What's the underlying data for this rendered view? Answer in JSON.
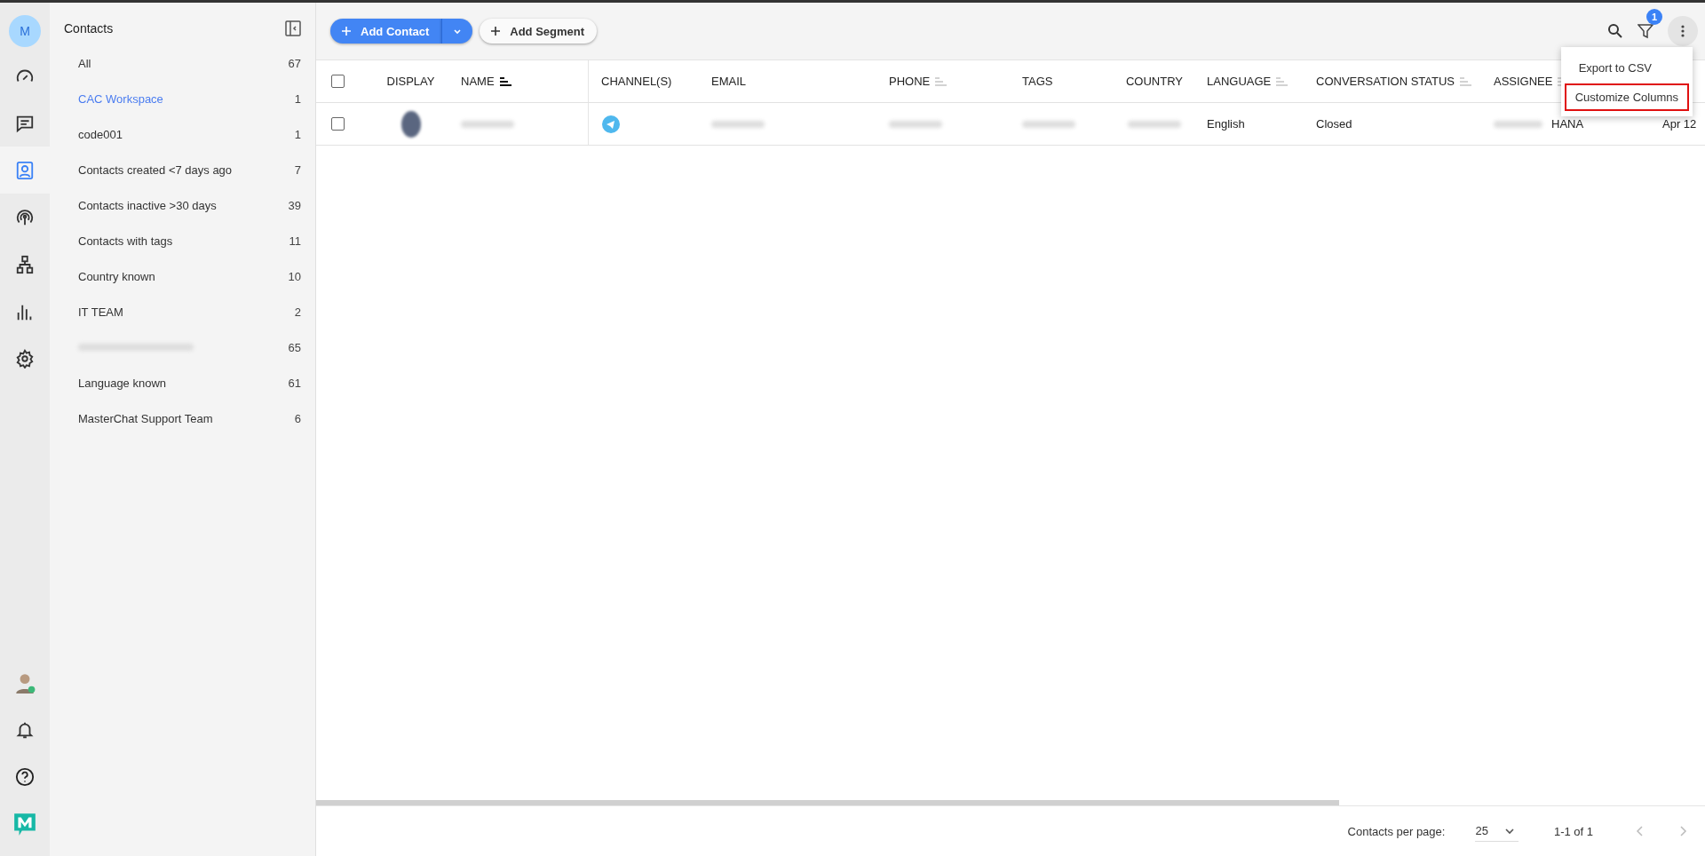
{
  "rail": {
    "avatar_initial": "M",
    "items": [
      {
        "selected": false
      },
      {
        "selected": false
      },
      {
        "selected": true
      },
      {
        "selected": false
      },
      {
        "selected": false
      },
      {
        "selected": false
      },
      {
        "selected": false
      }
    ]
  },
  "sidebar": {
    "title": "Contacts",
    "segments": [
      {
        "label": "All",
        "count": "67",
        "selected": false
      },
      {
        "label": "CAC Workspace",
        "count": "1",
        "selected": true
      },
      {
        "label": "code001",
        "count": "1",
        "selected": false
      },
      {
        "label": "Contacts created <7 days ago",
        "count": "7",
        "selected": false
      },
      {
        "label": "Contacts inactive >30 days",
        "count": "39",
        "selected": false
      },
      {
        "label": "Contacts with tags",
        "count": "11",
        "selected": false
      },
      {
        "label": "Country known",
        "count": "10",
        "selected": false
      },
      {
        "label": "IT TEAM",
        "count": "2",
        "selected": false
      },
      {
        "redacted": true,
        "count": "65",
        "selected": false
      },
      {
        "label": "Language known",
        "count": "61",
        "selected": false
      },
      {
        "label": "MasterChat Support Team",
        "count": "6",
        "selected": false
      }
    ]
  },
  "toolbar": {
    "add_contact": "Add Contact",
    "add_segment": "Add Segment",
    "filter_badge": "1"
  },
  "menu": {
    "items": [
      {
        "label": "Export to CSV",
        "highlighted": false
      },
      {
        "label": "Customize Columns",
        "highlighted": true
      }
    ]
  },
  "table": {
    "select_all_checked": false,
    "columns": [
      {
        "label": "DISPLAY",
        "sortable": false
      },
      {
        "label": "NAME",
        "sortable": true,
        "sort_active": true
      },
      {
        "label": "CHANNEL(S)",
        "sortable": false
      },
      {
        "label": "EMAIL",
        "sortable": false
      },
      {
        "label": "PHONE",
        "sortable": true,
        "sort_active": false
      },
      {
        "label": "TAGS",
        "sortable": false
      },
      {
        "label": "COUNTRY",
        "sortable": false
      },
      {
        "label": "LANGUAGE",
        "sortable": true,
        "sort_active": false
      },
      {
        "label": "CONVERSATION STATUS",
        "sortable": true,
        "sort_active": false
      },
      {
        "label": "ASSIGNEE",
        "sortable": true,
        "sort_active": false
      }
    ],
    "rows": [
      {
        "checked": false,
        "cells": [
          {
            "kind": "photo"
          },
          {
            "kind": "redacted"
          },
          {
            "kind": "channel"
          },
          {
            "kind": "redacted"
          },
          {
            "kind": "redacted"
          },
          {
            "kind": "redacted"
          },
          {
            "kind": "redacted"
          },
          {
            "kind": "text",
            "text": "English"
          },
          {
            "kind": "text",
            "text": "Closed"
          },
          {
            "kind": "partial",
            "text": "HANA"
          },
          {
            "kind": "text",
            "text": "Apr 12"
          }
        ]
      }
    ]
  },
  "pagination": {
    "label": "Contacts per page:",
    "per_page": "25",
    "range": "1-1 of 1"
  }
}
